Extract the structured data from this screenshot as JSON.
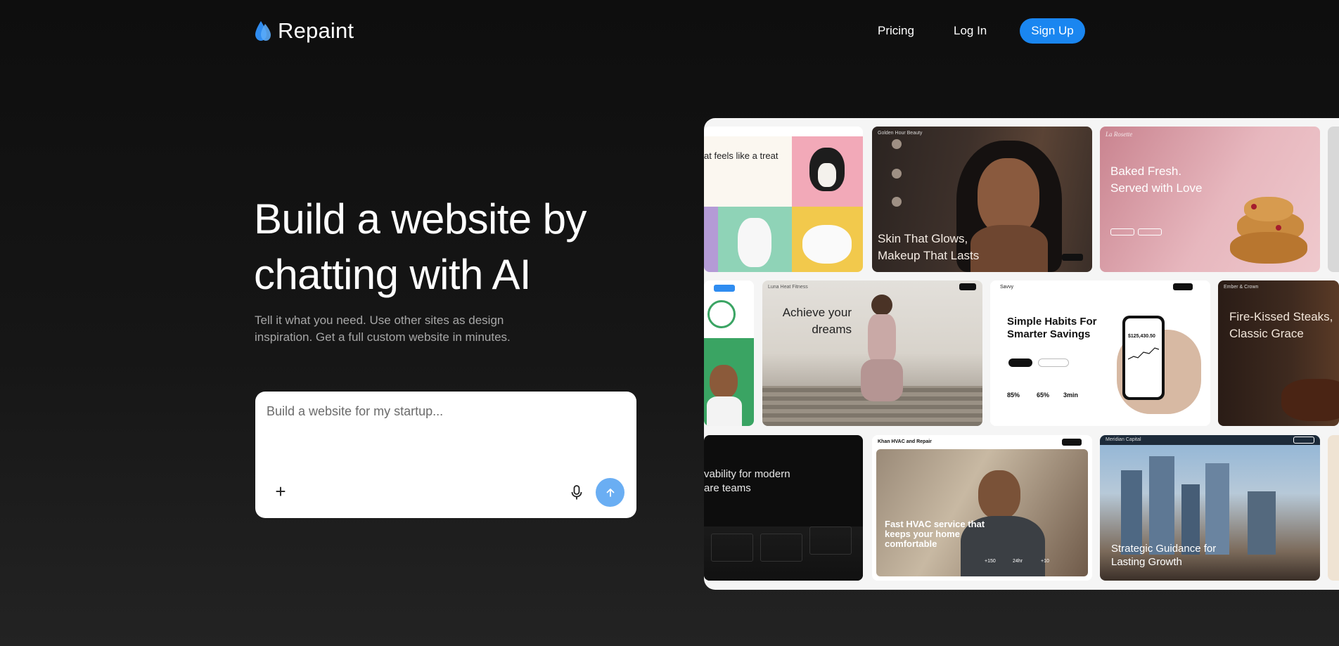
{
  "brand": {
    "name": "Repaint",
    "accent": "#1a86f0"
  },
  "nav": {
    "links": [
      {
        "label": "Pricing"
      },
      {
        "label": "Log In"
      }
    ],
    "signup_label": "Sign Up"
  },
  "hero": {
    "title": "Build a website by chatting with AI",
    "subtitle": "Tell it what you need. Use other sites as design inspiration. Get a full custom website in minutes."
  },
  "prompt": {
    "placeholder": "Build a website for my startup...",
    "icons": {
      "add": "plus-icon",
      "voice": "microphone-icon",
      "send": "arrow-up-icon"
    }
  },
  "gallery": {
    "cards": [
      {
        "title": "at feels like a treat",
        "brand": ""
      },
      {
        "title": "Skin That Glows, Makeup That Lasts",
        "brand": "Golden Hour Beauty"
      },
      {
        "title": "Baked Fresh. Served with Love",
        "brand": "La Rosette"
      },
      {
        "title": "",
        "brand": ""
      },
      {
        "title": "Achieve your dreams",
        "brand": "Luna Heat Fitness"
      },
      {
        "title": "Simple Habits For Smarter Savings",
        "brand": "Savvy",
        "stats": [
          "85%",
          "65%",
          "3min"
        ],
        "phone_value": "$125,430.50"
      },
      {
        "title": "Fire-Kissed Steaks, Classic Grace",
        "brand": "Ember & Crown"
      },
      {
        "title": "vability for modern are teams",
        "brand": ""
      },
      {
        "title": "Fast HVAC service that keeps your home comfortable",
        "brand": "Khan HVAC and Repair",
        "stats": [
          "+150",
          "24hr",
          "+10"
        ]
      },
      {
        "title": "Strategic Guidance for Lasting Growth",
        "brand": "Meridian Capital"
      }
    ]
  }
}
